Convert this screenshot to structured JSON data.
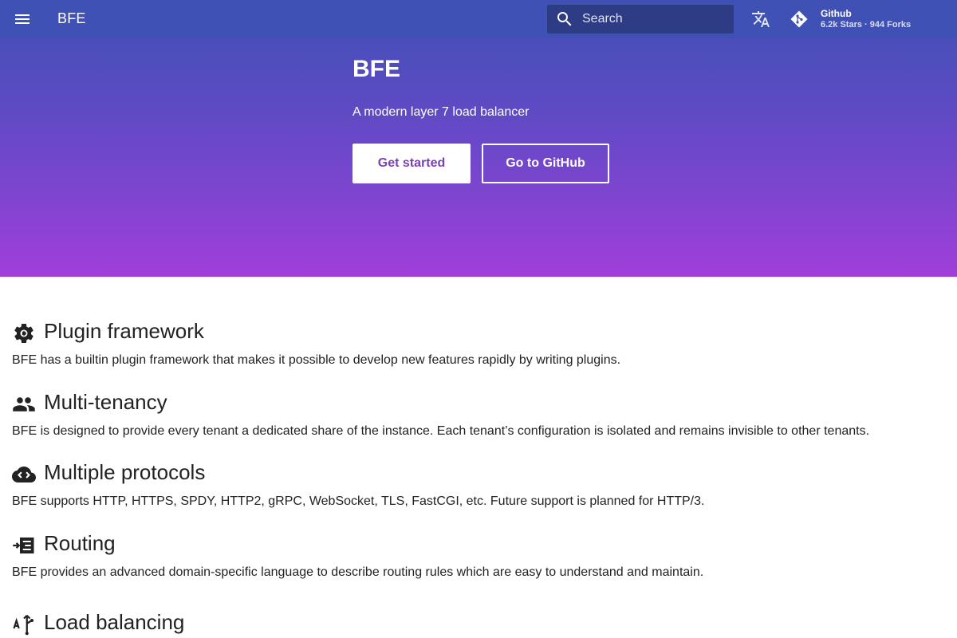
{
  "header": {
    "site_title": "BFE",
    "search": {
      "placeholder": "Search",
      "value": ""
    },
    "repo": {
      "name": "Github",
      "facts": "6.2k Stars · 944 Forks"
    }
  },
  "hero": {
    "title": "BFE",
    "subtitle": "A modern layer 7 load balancer",
    "primary_button": "Get started",
    "secondary_button": "Go to GitHub"
  },
  "features": [
    {
      "icon": "gear-plugin-icon",
      "title": "Plugin framework",
      "description": "BFE has a builtin plugin framework that makes it possible to develop new features rapidly by writing plugins."
    },
    {
      "icon": "people-icon",
      "title": "Multi-tenancy",
      "description": "BFE is designed to provide every tenant a dedicated share of the instance. Each tenant’s configuration is isolated and remains invisible to other tenants."
    },
    {
      "icon": "cloud-code-icon",
      "title": "Multiple protocols",
      "description": "BFE supports HTTP, HTTPS, SPDY, HTTP2, gRPC, WebSocket, TLS, FastCGI, etc. Future support is planned for HTTP/3."
    },
    {
      "icon": "routing-icon",
      "title": "Routing",
      "description": "BFE provides an advanced domain-specific language to describe routing rules which are easy to understand and maintain."
    },
    {
      "icon": "load-balancing-icon",
      "title": "Load balancing",
      "description": ""
    }
  ],
  "colors": {
    "header_bar": "#3f51b5",
    "gradient_bottom": "#a13edb",
    "primary_button_text": "#7b3fb8"
  }
}
